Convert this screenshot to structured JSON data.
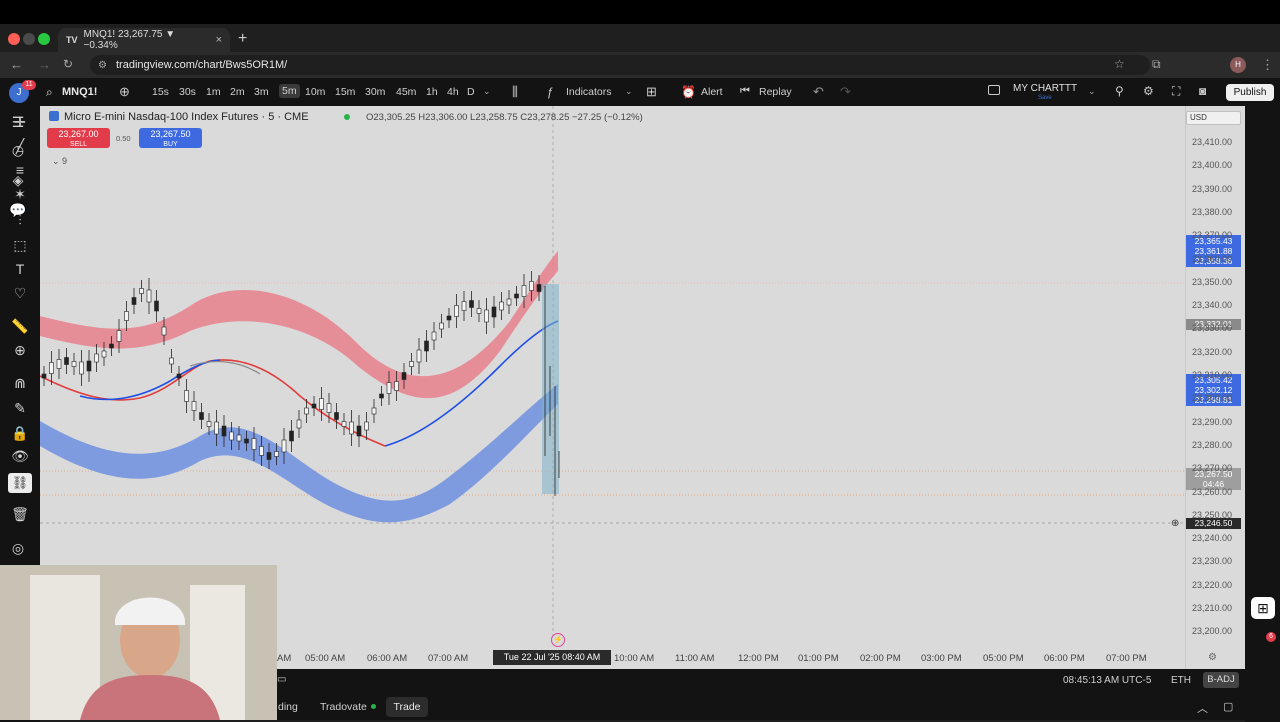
{
  "browser": {
    "tab_title": "MNQ1! 23,267.75 ▼ −0.34%",
    "url": "tradingview.com/chart/Bws5OR1M/",
    "tab_close": "×",
    "new_tab": "+"
  },
  "toolbar": {
    "symbol": "MNQ1!",
    "timeframes": [
      "15s",
      "30s",
      "1m",
      "2m",
      "3m",
      "5m",
      "10m",
      "15m",
      "30m",
      "45m",
      "1h",
      "4h",
      "D"
    ],
    "active_timeframe": "5m",
    "indicators": "Indicators",
    "alert": "Alert",
    "replay": "Replay",
    "layout_name": "MY CHARTTT",
    "layout_sub": "Save",
    "publish": "Publish",
    "avatar_badge": "11"
  },
  "legend": {
    "title": "Micro E-mini Nasdaq-100 Index Futures · 5 · CME",
    "ohlc": "O23,305.25  H23,306.00  L23,258.75  C23,278.25  −27.25 (−0.12%)",
    "sell_price": "23,267.00",
    "sell_label": "SELL",
    "spread": "0.50",
    "buy_price": "23,267.50",
    "buy_label": "BUY",
    "indicator_count": "9",
    "currency": "USD"
  },
  "y_axis": [
    "23,410.00",
    "23,400.00",
    "23,390.00",
    "23,380.00",
    "23,370.00",
    "23,360.00",
    "23,350.00",
    "23,340.00",
    "23,330.00",
    "23,320.00",
    "23,310.00",
    "23,300.00",
    "23,290.00",
    "23,280.00",
    "23,270.00",
    "23,260.00",
    "23,250.00",
    "23,240.00",
    "23,230.00",
    "23,220.00",
    "23,210.00",
    "23,200.00"
  ],
  "price_tags": {
    "upper": [
      "23,365.43",
      "23,361.88",
      "23,358.36"
    ],
    "mid_grey": "23,332.01",
    "lower": [
      "23,305.42",
      "23,302.12",
      "23,298.81"
    ],
    "last": "23,267.50",
    "countdown": "04:46",
    "crosshair": "23,246.50"
  },
  "x_axis": {
    "labels": [
      "AM",
      "05:00 AM",
      "06:00 AM",
      "07:00 AM",
      "10:00 AM",
      "11:00 AM",
      "12:00 PM",
      "01:00 PM",
      "02:00 PM",
      "03:00 PM",
      "05:00 PM",
      "06:00 PM",
      "07:00 PM"
    ],
    "cursor": "Tue 22 Jul '25   08:40 AM"
  },
  "status": {
    "time": "08:45:13 AM UTC-5",
    "session": "ETH",
    "adj": "B-ADJ"
  },
  "bottom_tabs": [
    "ding",
    "Tradovate",
    "Trade"
  ],
  "notif_badge": "6",
  "colors": {
    "red_band": "#e8808c",
    "blue_band": "#6f8fe0",
    "blue_line": "#1d4fe6",
    "red_line": "#e23b3b",
    "sell": "#e23c4b",
    "buy": "#3d6ae0"
  }
}
